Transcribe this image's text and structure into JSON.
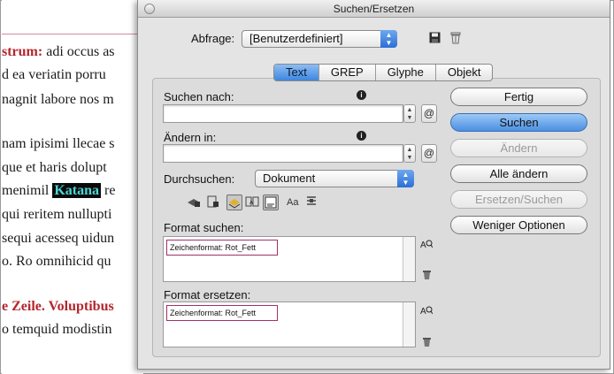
{
  "document": {
    "lines": [
      {
        "bold_red": "strum:",
        "rest": " adi occus as"
      },
      {
        "text": "d ea veriatin porru"
      },
      {
        "text": "nagnit labore nos m"
      },
      {
        "text": "nam ipisimi llecae s"
      },
      {
        "text": "que et haris dolupt"
      },
      {
        "before": "menimil ",
        "highlight": "Katana",
        "after": " re"
      },
      {
        "text": "qui reritem nullupti"
      },
      {
        "text": "sequi acesseq uidun"
      },
      {
        "text": "o. Ro omnihicid qu"
      },
      {
        "bold_red": "e Zeile. Voluptibus",
        "rest": ""
      },
      {
        "text": "o temquid modistin"
      }
    ]
  },
  "dialog": {
    "title": "Suchen/Ersetzen",
    "query_label": "Abfrage:",
    "query_value": "[Benutzerdefiniert]",
    "tabs": [
      {
        "label": "Text",
        "active": true
      },
      {
        "label": "GREP",
        "active": false
      },
      {
        "label": "Glyphe",
        "active": false
      },
      {
        "label": "Objekt",
        "active": false
      }
    ],
    "find_label": "Suchen nach:",
    "find_value": "",
    "change_label": "Ändern in:",
    "change_value": "",
    "search_label": "Durchsuchen:",
    "search_value": "Dokument",
    "option_case": "Aa",
    "format_find_label": "Format suchen:",
    "format_find_value": "Zeichenformat: Rot_Fett",
    "format_change_label": "Format ersetzen:",
    "format_change_value": "Zeichenformat: Rot_Fett",
    "buttons": {
      "done": "Fertig",
      "find": "Suchen",
      "change": "Ändern",
      "change_all": "Alle ändern",
      "change_find": "Ersetzen/Suchen",
      "fewer": "Weniger Optionen"
    },
    "colors": {
      "accent": "#4b8fe2",
      "highlight_border": "#a0306b",
      "doc_red": "#b3262e"
    }
  }
}
